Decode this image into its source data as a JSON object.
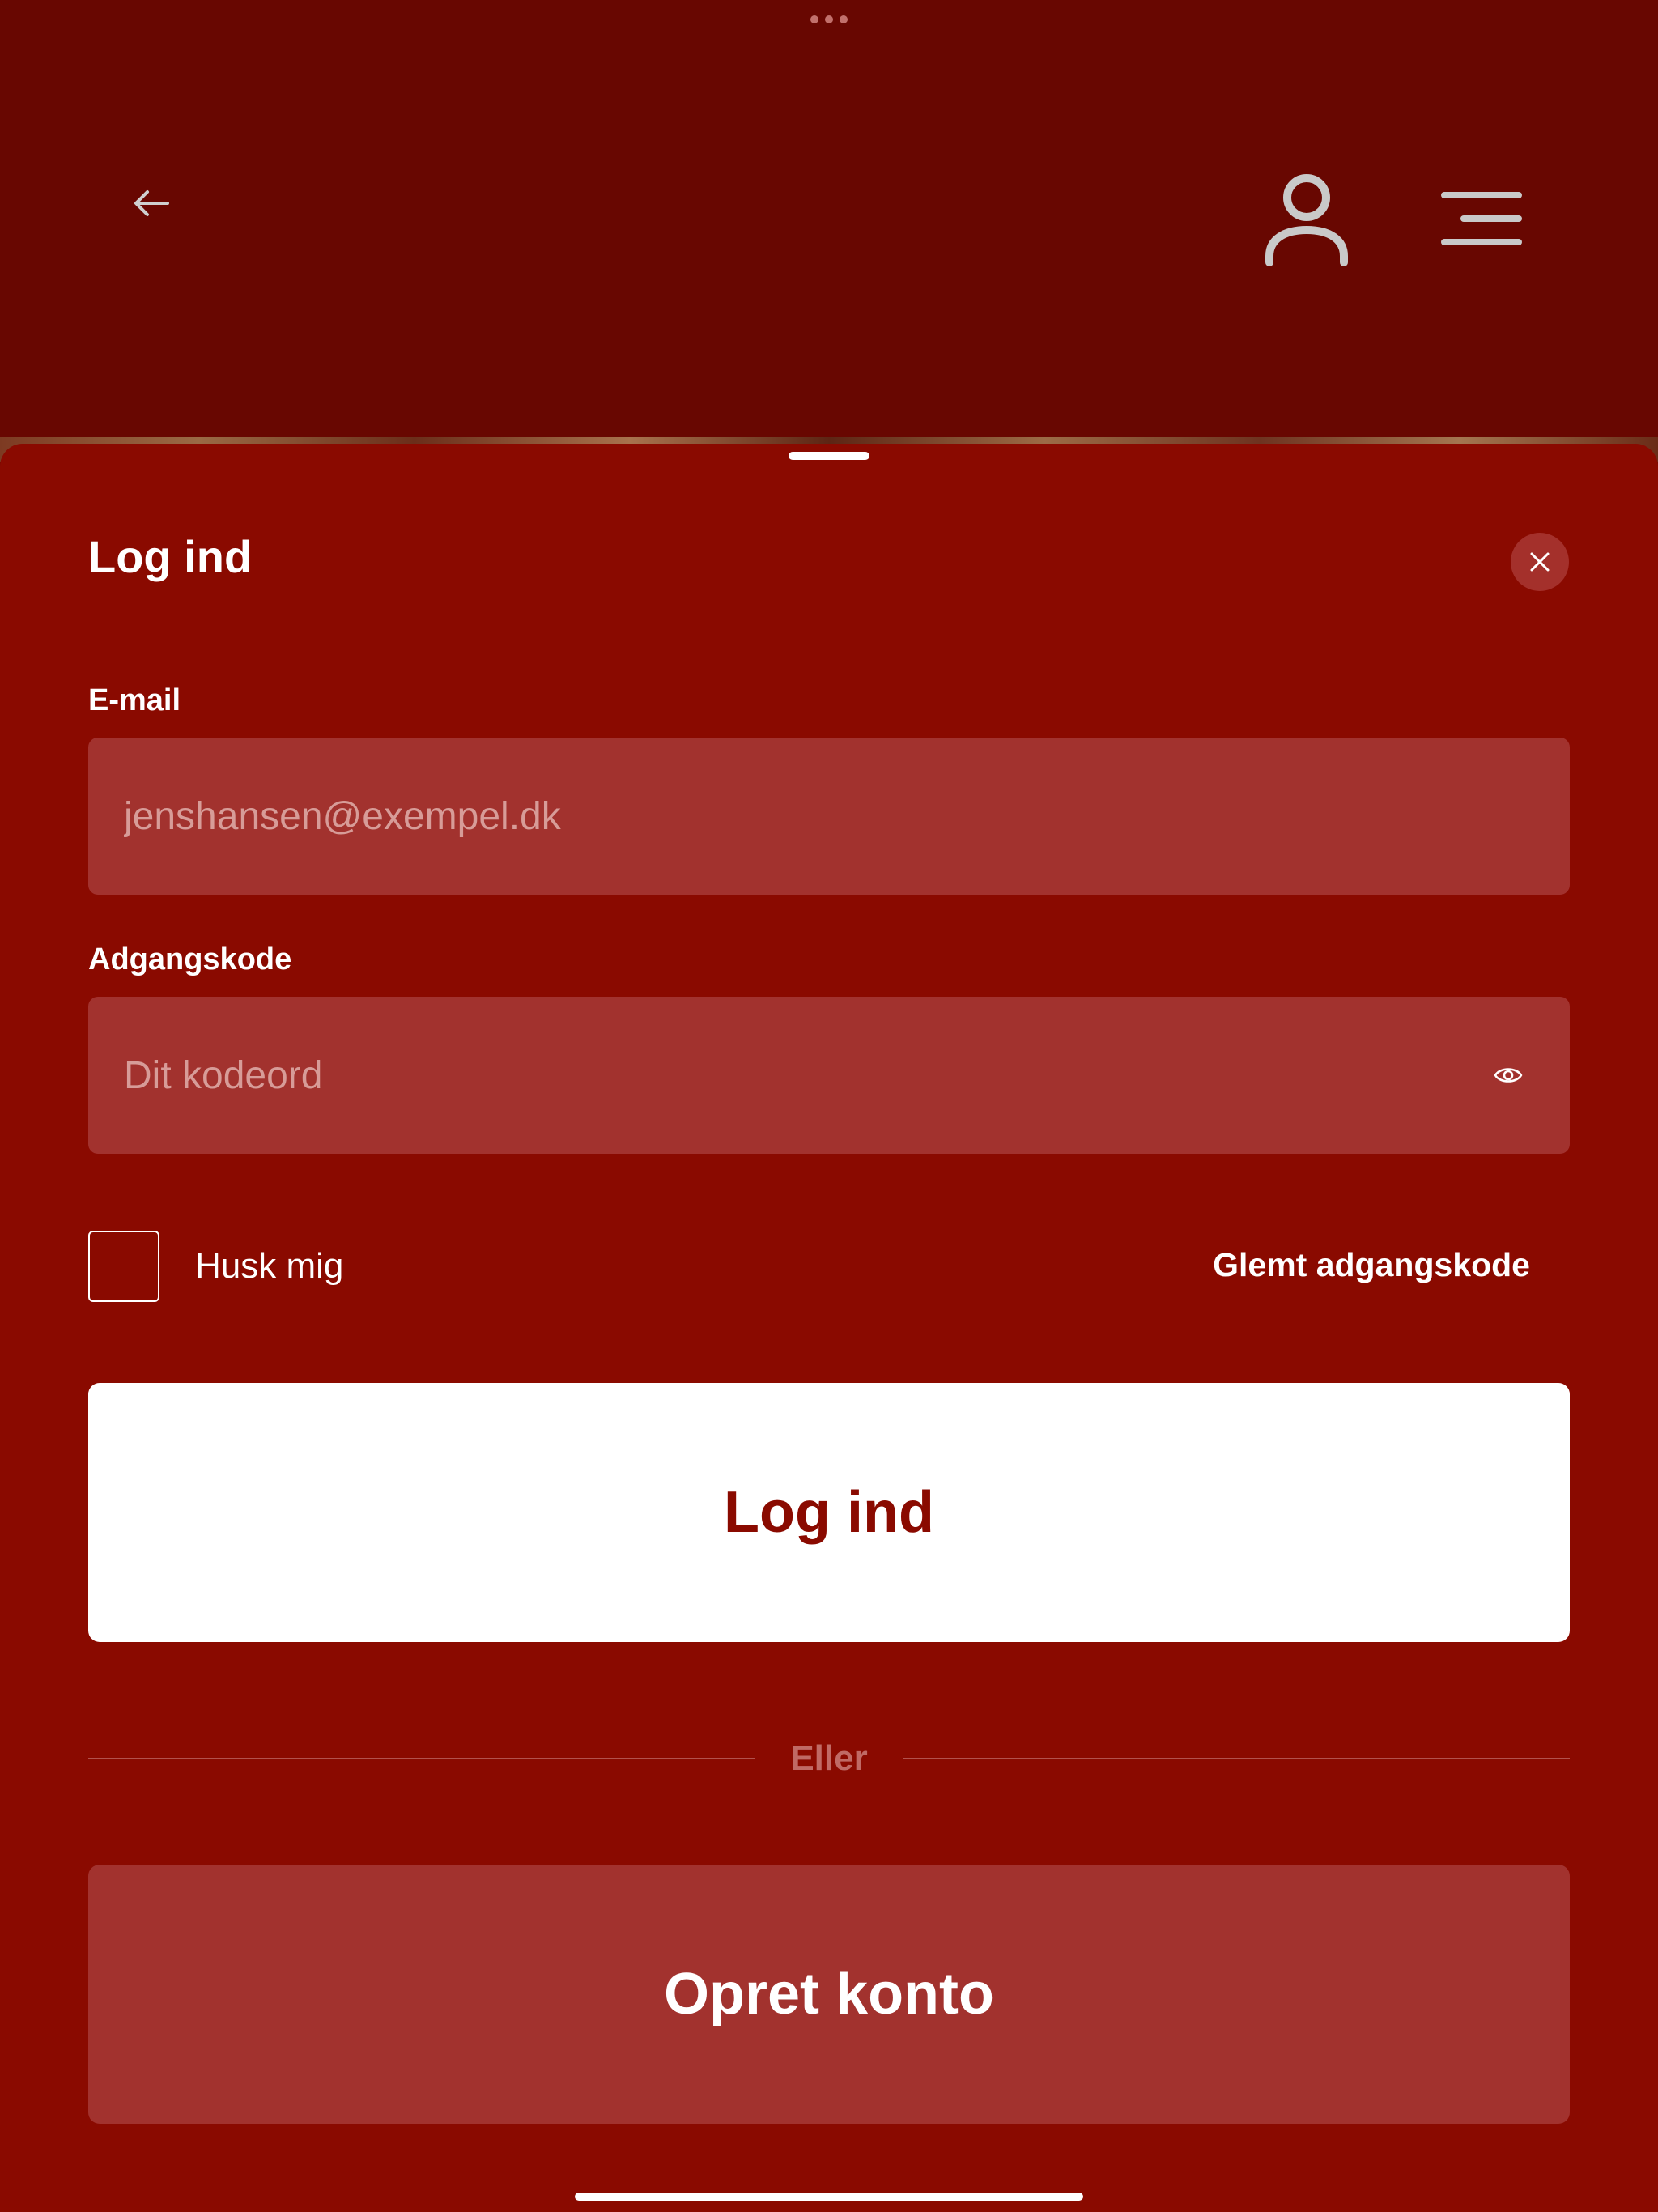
{
  "header": {
    "back_icon": "arrow-left-icon",
    "account_icon": "user-icon",
    "menu_icon": "hamburger-menu-icon",
    "multitask_icon": "more-dots-icon"
  },
  "login_sheet": {
    "title": "Log ind",
    "close_icon": "close-icon",
    "email": {
      "label": "E-mail",
      "placeholder": "jenshansen@exempel.dk",
      "value": ""
    },
    "password": {
      "label": "Adgangskode",
      "placeholder": "Dit kodeord",
      "value": "",
      "toggle_icon": "eye-icon"
    },
    "remember_me": {
      "label": "Husk mig",
      "checked": false
    },
    "forgot_password_label": "Glemt adgangskode",
    "login_button_label": "Log ind",
    "divider_label": "Eller",
    "create_account_button_label": "Opret konto"
  },
  "colors": {
    "header_background": "#680701",
    "sheet_background": "#8a0a00",
    "field_background": "#a2322e",
    "primary_button_background": "#ffffff",
    "primary_button_text": "#8a0a00",
    "text": "#ffffff"
  }
}
